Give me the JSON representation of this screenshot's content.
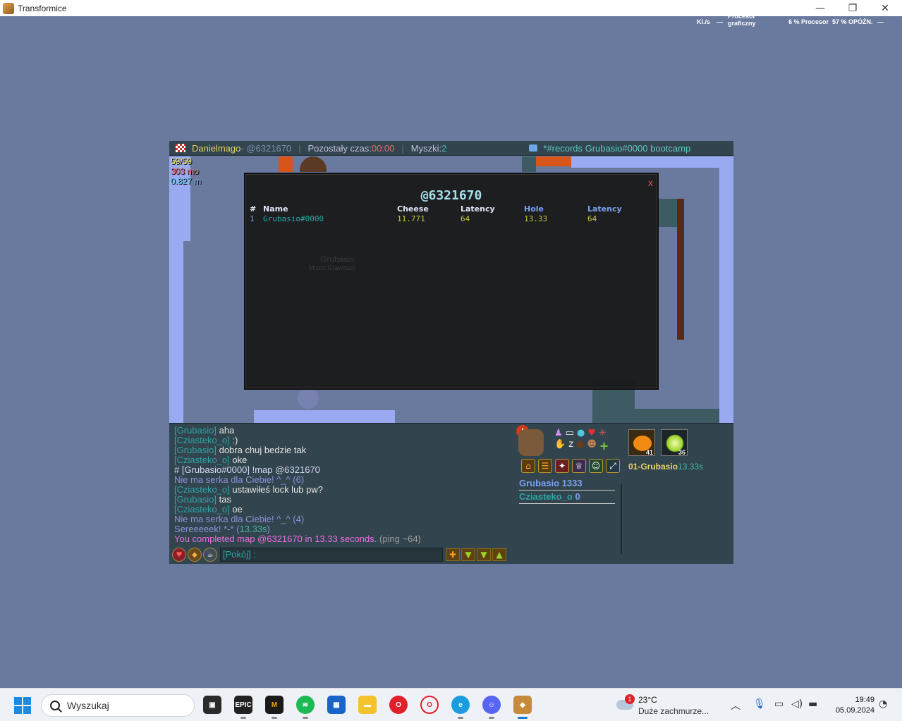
{
  "window": {
    "title": "Transformice",
    "minimize": "—",
    "restore": "❐",
    "close": "✕"
  },
  "perf": {
    "rate": "Kl./s",
    "rate_value": "—",
    "gpu_label": "Procesor graficzny",
    "cpu": "6 %  Procesor",
    "lat": "57 %  OPÓŹN.",
    "lat_value": "—"
  },
  "hud": {
    "player": "Danielmago",
    "map_code": " - @6321670",
    "sep": "|",
    "time_label": "Pozostały czas: ",
    "time_value": "00:00",
    "mice_label": "Myszki: ",
    "mice_value": "2",
    "room_note": "*#records Grubasio#0000 bootcamp"
  },
  "top_stats": {
    "fps": "59/59",
    "mo": "303 mo",
    "m": "0.827 m"
  },
  "colors": {
    "stat_fps": "#f5e05c",
    "stat_mo": "#f06a6a",
    "stat_m": "#5ec9e6",
    "accent_teal": "#2fa4a6"
  },
  "modal": {
    "title": "@6321670",
    "close": "x",
    "headers": [
      "#",
      "Name",
      "Cheese",
      "Latency",
      "Hole",
      "Latency"
    ],
    "rows": [
      [
        "1",
        "Grubasio#0000",
        "11.771",
        "64",
        "13.33",
        "64"
      ]
    ]
  },
  "ghost": {
    "name": "Grubasio",
    "title": "Mistrz Grawitacji"
  },
  "chat": {
    "l1": {
      "name": "[Grubasio]",
      "text": " aha"
    },
    "l2": {
      "name": "[Cziasteko_o]",
      "text": " :)"
    },
    "l3": {
      "name": "[Grubasio]",
      "text": " dobra chuj bedzie tak"
    },
    "l4": {
      "name": "[Cziasteko_o]",
      "text": " oke"
    },
    "l5": {
      "text": "# [Grubasio#0000] !map @6321670"
    },
    "l6": {
      "text": "Nie ma serka dla Ciebie! ^_^ (6)"
    },
    "l7": {
      "name": "[Cziasteko_o]",
      "text": " ustawiłeś lock lub pw?"
    },
    "l8": {
      "name": "[Grubasio]",
      "text": " tas"
    },
    "l9": {
      "name": "[Cziasteko_o]",
      "text": " oe"
    },
    "l10": {
      "text": "Nie ma serka dla Ciebie! ^_^ (4)"
    },
    "l11": {
      "text": "Sereeeeek! *-* (",
      "time": "13.33s",
      "close": ")"
    },
    "l12": {
      "text": "You completed map @6321670 in 13.33 seconds.",
      "ping": " (ping ~64)"
    }
  },
  "chat_input": {
    "value": "[Pokój] :"
  },
  "scores": [
    {
      "name": "Grubasio",
      "value": "1333"
    },
    {
      "name": "Cziasteko_o",
      "value": "0"
    }
  ],
  "cards": {
    "pumpkin_count": "41",
    "glow_count": "36"
  },
  "record": {
    "label": "01-Grubasio",
    "time": "13.33s"
  },
  "taskbar": {
    "search_placeholder": "Wyszukaj",
    "epic_label": "EPIC",
    "weather_temp": "23°C",
    "weather_desc": "Duże zachmurze...",
    "weather_badge": "1",
    "time": "19:49",
    "date": "05.09.2024"
  }
}
